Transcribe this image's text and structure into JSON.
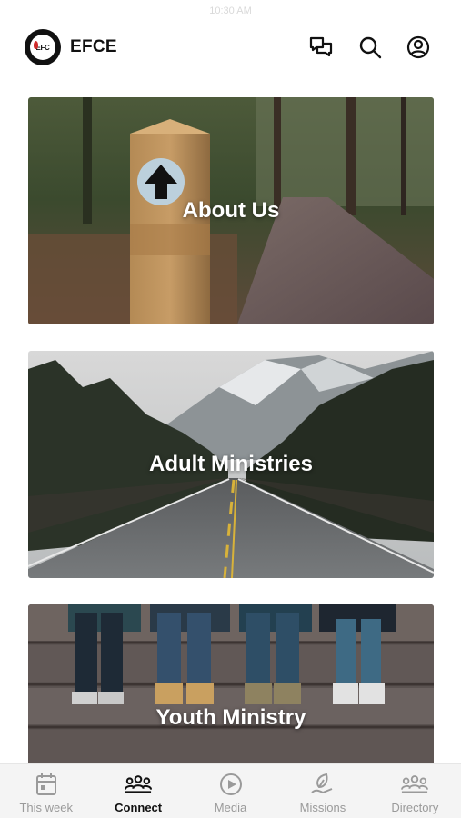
{
  "status_bar": {
    "time": "10:30 AM"
  },
  "header": {
    "app_title": "EFCE",
    "logo_text": "EFC",
    "icons": [
      "chat-icon",
      "search-icon",
      "account-icon"
    ]
  },
  "cards": [
    {
      "label": "About Us"
    },
    {
      "label": "Adult Ministries"
    },
    {
      "label": "Youth Ministry"
    }
  ],
  "tabs": [
    {
      "label": "This week",
      "icon": "calendar-icon",
      "active": false
    },
    {
      "label": "Connect",
      "icon": "people-icon",
      "active": true
    },
    {
      "label": "Media",
      "icon": "play-icon",
      "active": false
    },
    {
      "label": "Missions",
      "icon": "leaf-hand-icon",
      "active": false
    },
    {
      "label": "Directory",
      "icon": "group-icon",
      "active": false
    }
  ],
  "colors": {
    "active_tab": "#111111",
    "inactive_tab": "#9a9a9a",
    "tabbar_bg": "#f4f4f4"
  }
}
